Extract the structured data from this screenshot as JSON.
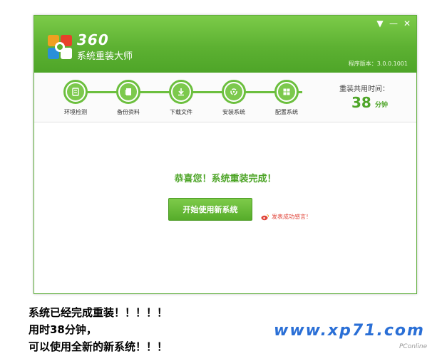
{
  "app": {
    "brand_number": "360",
    "brand_name": "系统重装大师",
    "version": "程序版本：3.0.0.1001",
    "window_controls": {
      "menu": "▼",
      "minimize": "—",
      "close": "✕"
    }
  },
  "steps": [
    {
      "label": "环境检测",
      "icon": "monitor-icon"
    },
    {
      "label": "备份资料",
      "icon": "document-icon"
    },
    {
      "label": "下载文件",
      "icon": "download-icon"
    },
    {
      "label": "安装系统",
      "icon": "recycle-icon"
    },
    {
      "label": "配置系统",
      "icon": "windows-icon"
    }
  ],
  "timer": {
    "label": "重装共用时间：",
    "value": "38",
    "unit": "分钟"
  },
  "main": {
    "message": "恭喜您！系统重装完成！",
    "start_button": "开始使用新系统",
    "share_link": "发表成功感言！"
  },
  "caption": {
    "line1": "系统已经完成重装！！！！！",
    "line2": "用时38分钟，",
    "line3": "可以使用全新的新系统！！！"
  },
  "watermark": {
    "site": "www.xp71.com",
    "source": "PConline"
  },
  "colors": {
    "accent": "#5db132",
    "link": "#e0453a",
    "watermark": "#2a6fd6"
  }
}
